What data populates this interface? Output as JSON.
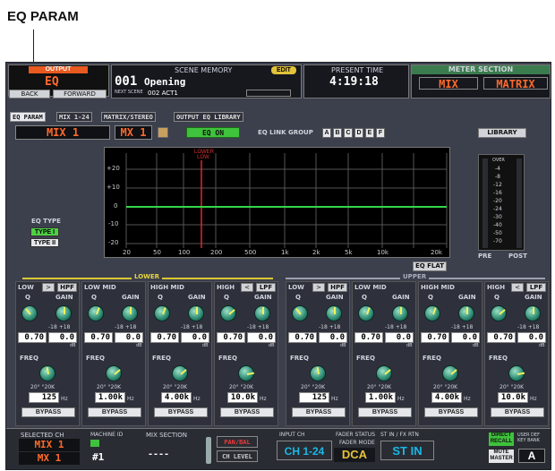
{
  "annotation": "EQ PARAM",
  "header": {
    "output_label": "OUTPUT",
    "output_value": "EQ",
    "back": "BACK",
    "forward": "FORWARD",
    "scene_memory": "SCENE MEMORY",
    "edit": "EDIT",
    "scene_number": "001",
    "scene_name": "Opening",
    "next_scene_label": "NEXT SCENE",
    "next_scene": "002 ACT1",
    "present_time": "PRESENT TIME",
    "time": "4:19:18",
    "meter_section": "METER SECTION",
    "meter_mix": "MIX",
    "meter_matrix": "MATRIX"
  },
  "tabs": [
    {
      "label": "EQ PARAM"
    },
    {
      "label": "MIX 1-24"
    },
    {
      "label": "MATRIX/STEREO"
    },
    {
      "label": "OUTPUT EQ LIBRARY"
    }
  ],
  "channel": {
    "name": "MIX 1",
    "short": "MX 1",
    "eq_on": "EQ ON",
    "link_group_label": "EQ LINK GROUP",
    "link_groups": [
      "A",
      "B",
      "C",
      "D",
      "E",
      "F"
    ],
    "library": "LIBRARY"
  },
  "eq_type": {
    "label": "EQ TYPE",
    "type1": "TYPE I",
    "type2": "TYPE II"
  },
  "graph": {
    "marker": "LOWER\nLOW",
    "y_ticks": [
      "+20",
      "+10",
      "0",
      "-10",
      "-20"
    ],
    "x_ticks": [
      "20",
      "50",
      "100",
      "200",
      "500",
      "1k",
      "2k",
      "5k",
      "10k",
      "20k"
    ],
    "eq_flat": "EQ FLAT"
  },
  "meter": {
    "over": "OVER",
    "ticks": [
      "-4",
      "-8",
      "-12",
      "-16",
      "-20",
      "-24",
      "-30",
      "-40",
      "-50",
      "-70"
    ],
    "pre": "PRE",
    "post": "POST"
  },
  "sections": {
    "lower": "LOWER",
    "upper": "UPPER"
  },
  "bands": [
    {
      "name": "LOW",
      "mode": "HPF",
      "q": "0.70",
      "gain": "0.0",
      "freq": "125",
      "unit": "Hz"
    },
    {
      "name": "LOW MID",
      "q": "0.70",
      "gain": "0.0",
      "freq": "1.00k",
      "unit": "Hz"
    },
    {
      "name": "HIGH MID",
      "q": "0.70",
      "gain": "0.0",
      "freq": "4.00k",
      "unit": "Hz"
    },
    {
      "name": "HIGH",
      "mode": "LPF",
      "q": "0.70",
      "gain": "0.0",
      "freq": "10.0k",
      "unit": "Hz"
    },
    {
      "name": "LOW",
      "mode": "HPF",
      "q": "0.70",
      "gain": "0.0",
      "freq": "125",
      "unit": "Hz"
    },
    {
      "name": "LOW MID",
      "q": "0.70",
      "gain": "0.0",
      "freq": "1.00k",
      "unit": "Hz"
    },
    {
      "name": "HIGH MID",
      "q": "0.70",
      "gain": "0.0",
      "freq": "4.00k",
      "unit": "Hz"
    },
    {
      "name": "HIGH",
      "mode": "LPF",
      "q": "0.70",
      "gain": "0.0",
      "freq": "10.0k",
      "unit": "Hz"
    }
  ],
  "band_labels": {
    "q": "Q",
    "gain": "GAIN",
    "freq": "FREQ",
    "range_q": "20° °20K",
    "gain_range": "-18 +18",
    "db": "dB",
    "bypass": "BYPASS"
  },
  "footer": {
    "selected_ch": "SELECTED CH",
    "sel_name": "MIX 1",
    "sel_short": "MX 1",
    "machine_id": "MACHINE ID",
    "machine_num": "#1",
    "mix_section": "MIX SECTION",
    "mix_value": "----",
    "pan_bal": "PAN/BAL",
    "ch_level": "CH LEVEL",
    "input_ch": "INPUT CH",
    "input_value": "CH 1-24",
    "fader_status": "FADER STATUS",
    "fader_mode": "FADER MODE",
    "fader_value": "DCA",
    "st_in_label": "ST IN / FX RTN",
    "st_in": "ST IN",
    "direct_recall": "DIRECT RECALL",
    "mute_master": "MUTE MASTER",
    "user_def": "USER DEF KEY BANK",
    "key_bank": "A"
  }
}
